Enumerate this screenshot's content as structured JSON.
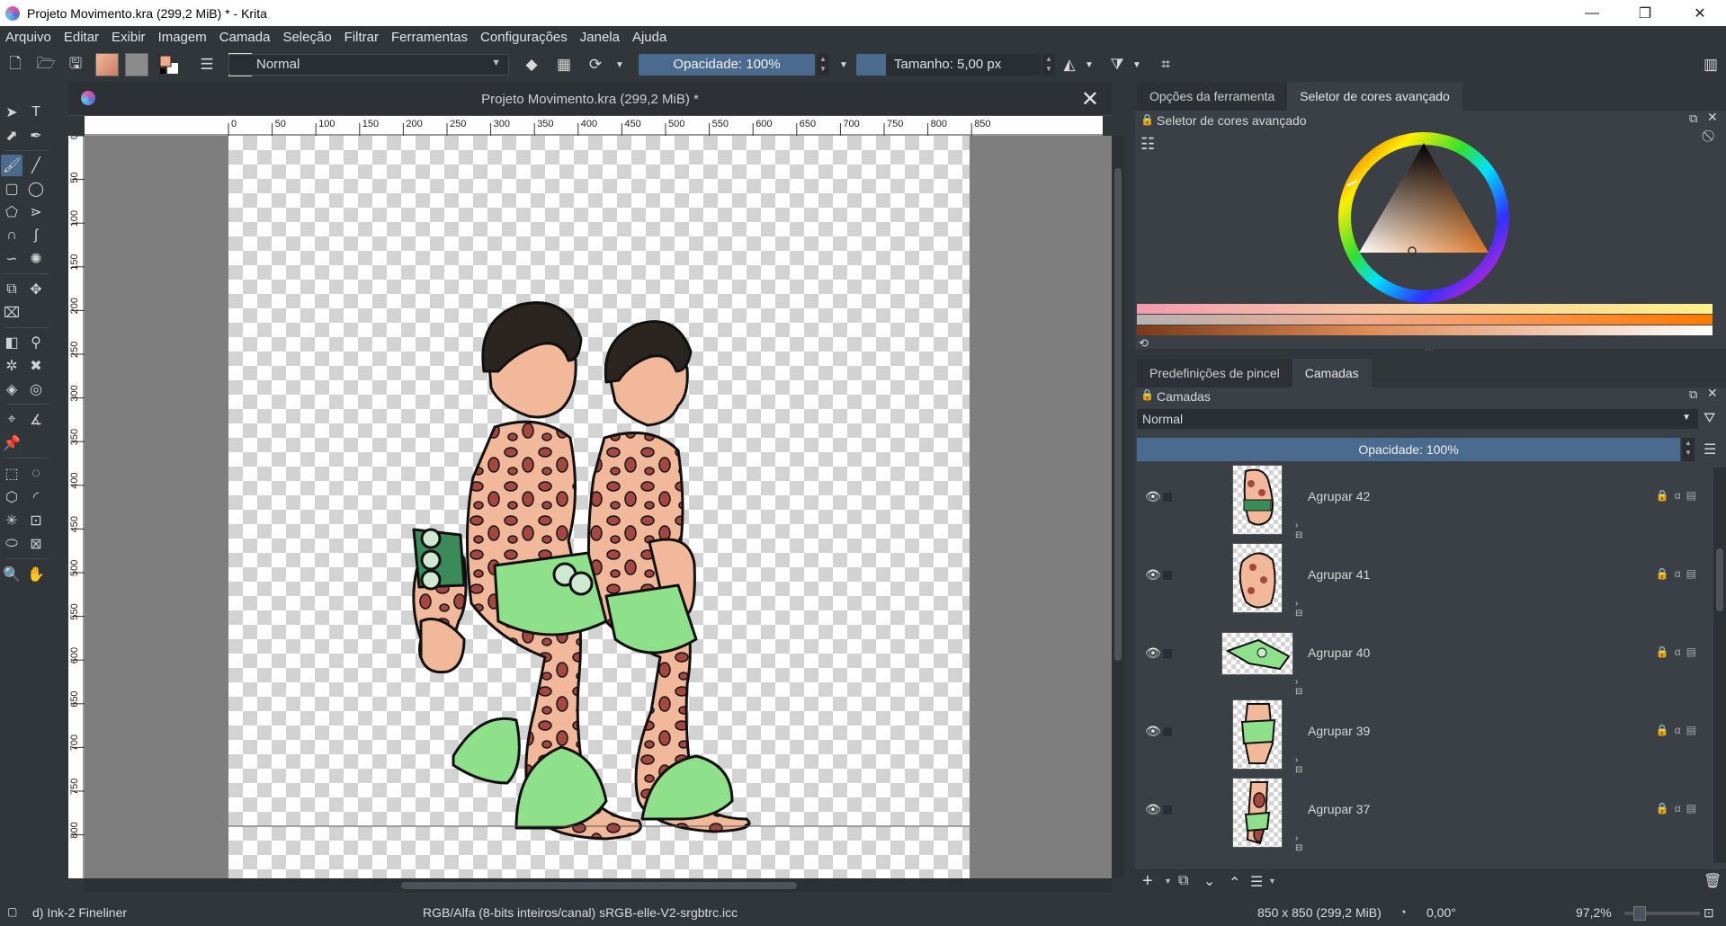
{
  "window": {
    "title": "Projeto Movimento.kra (299,2 MiB) * - Krita",
    "minimize": "—",
    "maximize": "❐",
    "close": "✕"
  },
  "menu": [
    "Arquivo",
    "Editar",
    "Exibir",
    "Imagem",
    "Camada",
    "Seleção",
    "Filtrar",
    "Ferramentas",
    "Configurações",
    "Janela",
    "Ajuda"
  ],
  "toolbar": {
    "blend_mode": "Normal",
    "opacity": "Opacidade: 100%",
    "size": "Tamanho: 5,00 px"
  },
  "document": {
    "tab_title": "Projeto Movimento.kra (299,2 MiB) *"
  },
  "rulers": {
    "h_ticks": [
      "0",
      "50",
      "100",
      "150",
      "200",
      "250",
      "300",
      "350",
      "400",
      "450",
      "500",
      "550",
      "600",
      "650",
      "700",
      "750",
      "800",
      "850"
    ],
    "v_ticks": [
      "0",
      "50",
      "100",
      "150",
      "200",
      "250",
      "300",
      "350",
      "400",
      "450",
      "500",
      "550",
      "600",
      "650",
      "700",
      "750",
      "800"
    ]
  },
  "top_dock": {
    "tabs": [
      "Opções da ferramenta",
      "Seletor de cores avançado"
    ],
    "active_tab": 1,
    "panel_title": "Seletor de cores avançado"
  },
  "colors": {
    "accent": "#4a6a8e",
    "fg_color": "#f2a98a",
    "bg_color": "#ffffff",
    "selected_hue": "#e07a2a"
  },
  "bottom_dock": {
    "tabs": [
      "Predefinições de pincel",
      "Camadas"
    ],
    "active_tab": 1,
    "panel_title": "Camadas",
    "blend_mode": "Normal",
    "opacity": "Opacidade:  100%",
    "layers": [
      {
        "name": "Agrupar  42",
        "visible": true,
        "thumb": "arm-with-bracelet"
      },
      {
        "name": "Agrupar  41",
        "visible": true,
        "thumb": "torso-spots"
      },
      {
        "name": "Agrupar  40",
        "visible": true,
        "thumb": "leaf-skirt"
      },
      {
        "name": "Agrupar  39",
        "visible": true,
        "thumb": "leg-with-leaves"
      },
      {
        "name": "Agrupar  37",
        "visible": true,
        "thumb": "arm-back"
      }
    ]
  },
  "status": {
    "brush": "d) Ink-2 Fineliner",
    "color_space": "RGB/Alfa (8-bits inteiros/canal)  sRGB-elle-V2-srgbtrc.icc",
    "dimensions": "850 x 850 (299,2 MiB)",
    "rotation": "0,00°",
    "zoom": "97,2%"
  }
}
